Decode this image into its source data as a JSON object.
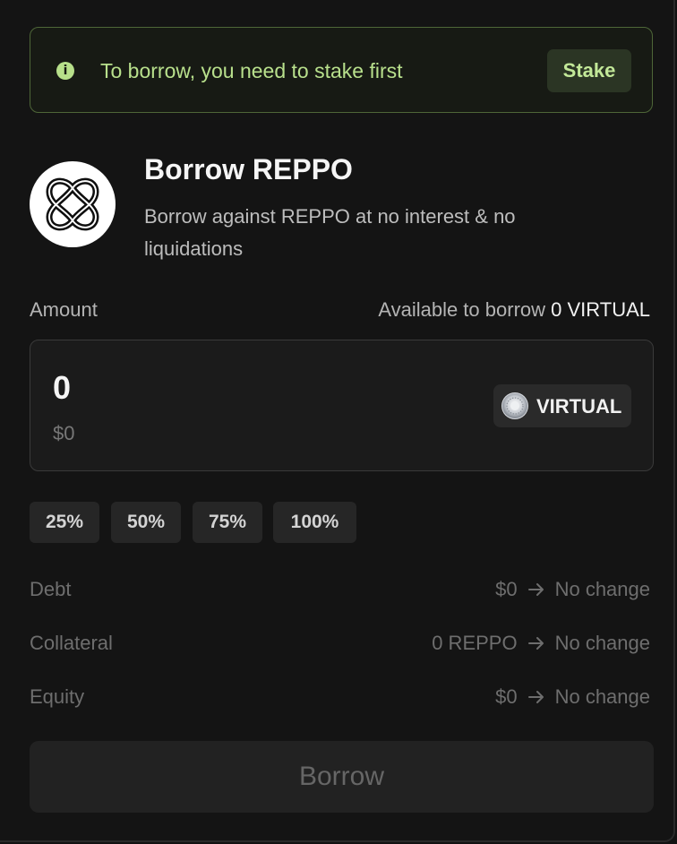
{
  "alert": {
    "message": "To borrow, you need to stake first",
    "action_label": "Stake",
    "icon": "info-icon"
  },
  "header": {
    "logo_icon": "reppo-logo-icon",
    "title": "Borrow REPPO",
    "subtitle": "Borrow against REPPO at no interest & no liquidations"
  },
  "amount": {
    "label": "Amount",
    "available_prefix": "Available to borrow",
    "available_value": "0 VIRTUAL",
    "input_value": "0",
    "usd_value": "$0",
    "token_label": "VIRTUAL",
    "token_icon": "virtual-token-icon"
  },
  "percent_buttons": [
    "25%",
    "50%",
    "75%",
    "100%"
  ],
  "summary": [
    {
      "label": "Debt",
      "current": "$0",
      "change": "No change"
    },
    {
      "label": "Collateral",
      "current": "0 REPPO",
      "change": "No change"
    },
    {
      "label": "Equity",
      "current": "$0",
      "change": "No change"
    }
  ],
  "borrow_button": {
    "label": "Borrow"
  },
  "colors": {
    "background": "#141414",
    "alert_border": "#4e6638",
    "alert_text": "#b8e08c",
    "muted_text": "#6e6e6e"
  }
}
